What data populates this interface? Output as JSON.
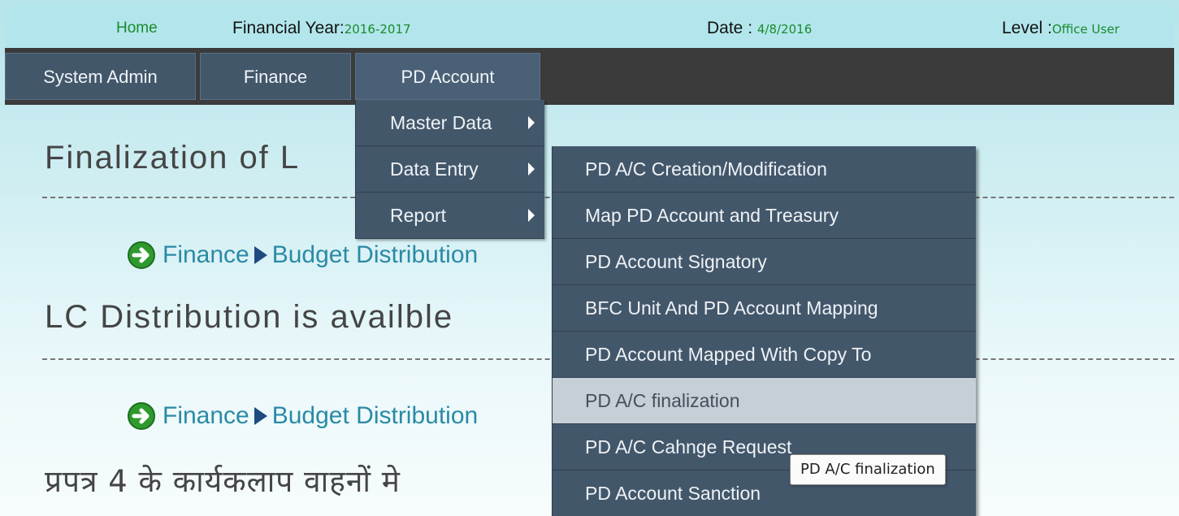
{
  "topbar": {
    "home": "Home",
    "financial_year_label": "Financial Year:",
    "financial_year": "2016-2017",
    "date_label": "Date : ",
    "date": "4/8/2016",
    "level_label": "Level :",
    "level": "Office User"
  },
  "nav": {
    "system_admin": "System Admin",
    "finance": "Finance",
    "pd_account": "PD Account"
  },
  "pd_menu": [
    "Master Data",
    "Data Entry",
    "Report"
  ],
  "data_entry_menu": [
    "PD A/C Creation/Modification",
    "Map PD Account and Treasury",
    "PD Account Signatory",
    "BFC Unit And PD Account Mapping",
    "PD Account Mapped With Copy To",
    "PD A/C finalization",
    "PD A/C Cahnge Request",
    "PD Account Sanction"
  ],
  "content": {
    "heading1": "Finalization of L",
    "heading2": "LC Distribution is availble",
    "heading3": "प्रपत्र 4 के कार्यकलाप वाहनों मे",
    "crumb_finance": "Finance",
    "crumb_budget": "Budget Distribution"
  },
  "tooltip": "PD A/C finalization",
  "colors": {
    "accent_green": "#1a8a2c",
    "menu_bg": "#43576b",
    "menu_hover": "#c6ced6",
    "link": "#2a8aa5"
  }
}
